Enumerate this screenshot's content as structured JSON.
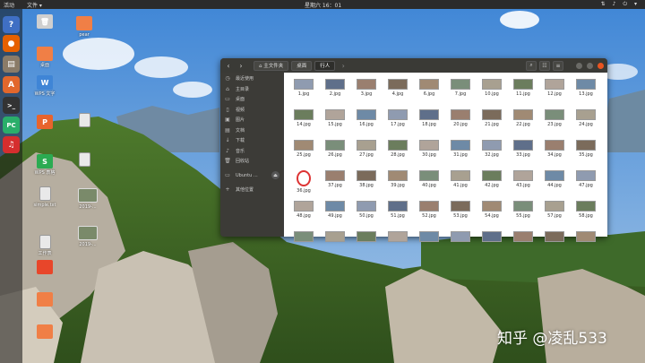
{
  "topbar": {
    "activities": "活动",
    "app_menu": "文件 ▾",
    "clock": "星期六 16：01",
    "tray": "⇅ ♪ ⏻ ▾"
  },
  "dock": [
    {
      "name": "help",
      "glyph": "?",
      "color": "#3f6fc4"
    },
    {
      "name": "firefox",
      "glyph": "●",
      "color": "#e66000"
    },
    {
      "name": "files",
      "glyph": "▤",
      "color": "#8a7b68"
    },
    {
      "name": "software",
      "glyph": "A",
      "color": "#e2672c"
    },
    {
      "name": "terminal",
      "glyph": ">_",
      "color": "#333333"
    },
    {
      "name": "pycharm",
      "glyph": "PC",
      "color": "#2aae6a"
    },
    {
      "name": "netease-music",
      "glyph": "♫",
      "color": "#d52e2e"
    }
  ],
  "desktop_icons": [
    {
      "label": "",
      "kind": "trash",
      "color": "#cfcfcf"
    },
    {
      "label": "pear",
      "kind": "folder",
      "color": "#f07f46"
    },
    {
      "label": "桌面",
      "kind": "folder",
      "color": "#f07f46"
    },
    {
      "label": "WPS 文字",
      "kind": "wps-w",
      "color": "#3f85d6"
    },
    {
      "label": "",
      "kind": "doc",
      "color": "#e9e9e9"
    },
    {
      "label": "",
      "kind": "wps-p",
      "color": "#e8642d"
    },
    {
      "label": "WPS 表格",
      "kind": "wps-s",
      "color": "#2bab52"
    },
    {
      "label": "",
      "kind": "doc",
      "color": "#e9e9e9"
    },
    {
      "label": "simple.txt",
      "kind": "text",
      "color": "#e9e9e9"
    },
    {
      "label": "2019-...",
      "kind": "image",
      "color": "#7a8a6a"
    },
    {
      "label": "工作表",
      "kind": "text",
      "color": "#e9e9e9"
    },
    {
      "label": "2019-...",
      "kind": "image",
      "color": "#7a8a6a"
    },
    {
      "label": "",
      "kind": "folder",
      "color": "#e8462a"
    },
    {
      "label": "",
      "kind": "folder",
      "color": "#f07f46"
    },
    {
      "label": "",
      "kind": "folder",
      "color": "#f07f46"
    }
  ],
  "window": {
    "nav_back": "‹",
    "nav_forward": "›",
    "breadcrumbs": [
      {
        "label": "⌂ 主文件夹",
        "active": false
      },
      {
        "label": "桌面",
        "active": false
      },
      {
        "label": "行人",
        "active": true
      }
    ],
    "breadcrumb_more": "›",
    "buttons": {
      "search": "⌕",
      "view": "☷",
      "menu": "≡"
    },
    "sidebar": [
      {
        "icon": "◷",
        "label": "最近使用"
      },
      {
        "icon": "⌂",
        "label": "主目录"
      },
      {
        "icon": "▭",
        "label": "桌面"
      },
      {
        "icon": "▯",
        "label": "视频"
      },
      {
        "icon": "▣",
        "label": "图片"
      },
      {
        "icon": "▤",
        "label": "文档"
      },
      {
        "icon": "↓",
        "label": "下载"
      },
      {
        "icon": "♪",
        "label": "音乐"
      },
      {
        "icon": "🗑",
        "label": "回收站"
      },
      {
        "icon": "▭",
        "label": "Ubuntu ..."
      },
      {
        "icon": "+",
        "label": "其他位置"
      }
    ],
    "eject": "⏏",
    "files": [
      "1.jpg",
      "2.jpg",
      "3.jpg",
      "4.jpg",
      "6.jpg",
      "7.jpg",
      "10.jpg",
      "11.jpg",
      "12.jpg",
      "13.jpg",
      "14.jpg",
      "15.jpg",
      "16.jpg",
      "17.jpg",
      "18.jpg",
      "20.jpg",
      "21.jpg",
      "22.jpg",
      "23.jpg",
      "24.jpg",
      "25.jpg",
      "26.jpg",
      "27.jpg",
      "28.jpg",
      "30.jpg",
      "31.jpg",
      "32.jpg",
      "33.jpg",
      "34.jpg",
      "35.jpg",
      "36.jpg",
      "37.jpg",
      "38.jpg",
      "39.jpg",
      "40.jpg",
      "41.jpg",
      "42.jpg",
      "43.jpg",
      "44.jpg",
      "47.jpg",
      "48.jpg",
      "49.jpg",
      "50.jpg",
      "51.jpg",
      "52.jpg",
      "53.jpg",
      "54.jpg",
      "55.jpg",
      "57.jpg",
      "58.jpg",
      "",
      "",
      "",
      "",
      "",
      "",
      "",
      "",
      "",
      ""
    ]
  },
  "watermark": "知乎 @凌乱533",
  "colors": {
    "accent": "#e95420",
    "sidebar": "#3c3b37",
    "header": "#3a3a36"
  }
}
